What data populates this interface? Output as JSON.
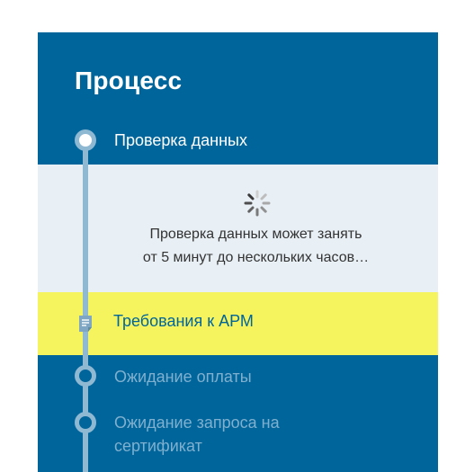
{
  "process": {
    "title": "Процесс",
    "steps": [
      {
        "label": "Проверка данных",
        "state": "active"
      },
      {
        "label": "Ожидание оплаты",
        "state": "pending"
      },
      {
        "label_line1": "Ожидание запроса на",
        "label_line2": "сертификат",
        "state": "pending"
      }
    ],
    "info": {
      "line1": "Проверка данных может занять",
      "line2": "от 5 минут до нескольких часов…"
    },
    "requirements_link": "Требования к АРМ"
  },
  "colors": {
    "panel_bg": "#00659b",
    "timeline": "#8fb8d3",
    "info_bg": "#e8f0f6",
    "highlight": "#f5f35e"
  },
  "icons": [
    "spinner-icon",
    "document-icon"
  ]
}
